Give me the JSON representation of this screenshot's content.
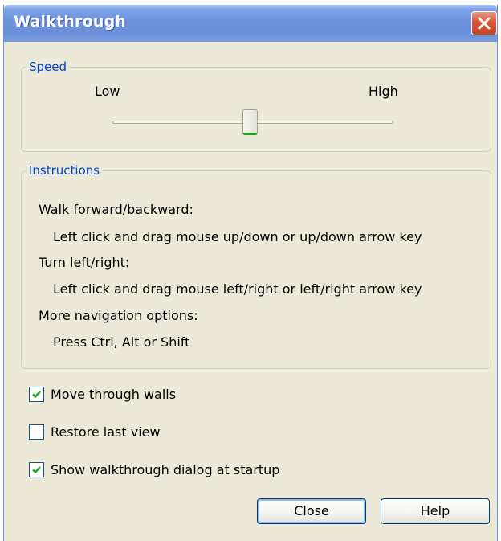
{
  "window": {
    "title": "Walkthrough"
  },
  "speed": {
    "legend": "Speed",
    "low_label": "Low",
    "high_label": "High",
    "slider_level": 0.47
  },
  "instructions": {
    "legend": "Instructions",
    "lines": [
      "Walk forward/backward:",
      "Left click and drag mouse up/down or up/down arrow key",
      "Turn left/right:",
      "Left click and drag mouse left/right or left/right arrow key",
      "More navigation options:",
      "Press Ctrl, Alt or Shift"
    ]
  },
  "options": [
    {
      "label": "Move through walls",
      "checked": true
    },
    {
      "label": "Restore last view",
      "checked": false
    },
    {
      "label": "Show walkthrough dialog at startup",
      "checked": true
    }
  ],
  "buttons": {
    "close_label": "Close",
    "help_label": "Help"
  },
  "icons": {
    "window_close": "close-x-icon",
    "checkmark": "checkmark-icon"
  },
  "colors": {
    "title_bar": "#6f93dd",
    "close_button": "#d8553a",
    "group_legend": "#0046d5",
    "slider_accent": "#21a121",
    "checkmark": "#21a121",
    "dialog_bg": "#ece9d8"
  }
}
